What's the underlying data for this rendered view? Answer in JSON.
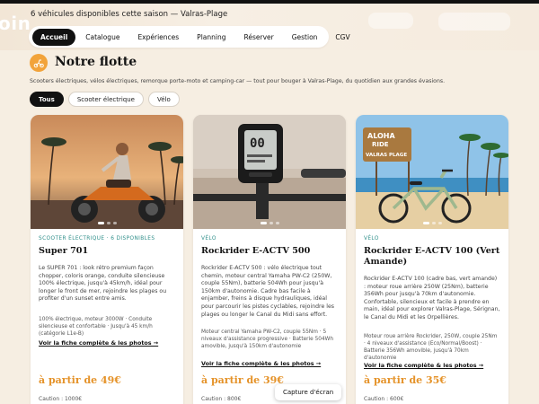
{
  "header": {
    "brand_fragment": "oin",
    "tagline": "6 véhicules disponibles cette saison — Valras-Plage"
  },
  "nav": {
    "items": [
      "Accueil",
      "Catalogue",
      "Expériences",
      "Planning",
      "Réserver",
      "Gestion",
      "CGV"
    ],
    "active": "Accueil"
  },
  "section": {
    "title": "Notre flotte",
    "description": "Scooters électriques, vélos électriques, remorque porte-moto et camping-car — tout pour bouger à Valras-Plage, du quotidien aux grandes évasions.",
    "icon": "scooter-icon"
  },
  "filters": [
    "Tous",
    "Scooter électrique",
    "Vélo"
  ],
  "cards": [
    {
      "category": "SCOOTER ÉLECTRIQUE · 6 DISPONIBLES",
      "name": "Super 701",
      "description": "Le SUPER 701 : look rétro premium façon chopper, coloris orange, conduite silencieuse 100% électrique, jusqu'à 45km/h, idéal pour longer le front de mer, rejoindre les plages ou profiter d'un sunset entre amis.",
      "specs": "100% électrique, moteur 3000W · Conduite silencieuse et confortable · Jusqu'à 45 km/h (catégorie L1e-B)",
      "link": "Voir la fiche complète & les photos →",
      "price": "à partir de 49€",
      "caution": "Caution : 1000€"
    },
    {
      "category": "VÉLO",
      "name": "Rockrider E-ACTV 500",
      "description": "Rockrider E-ACTV 500 : vélo électrique tout chemin, moteur central Yamaha PW-C2 (250W, couple 55Nm), batterie 504Wh pour jusqu'à 150km d'autonomie. Cadre bas facile à enjamber, freins à disque hydrauliques, idéal pour parcourir les pistes cyclables, rejoindre les plages ou longer le Canal du Midi sans effort.",
      "specs": "Moteur central Yamaha PW-C2, couple 55Nm · 5 niveaux d'assistance progressive · Batterie 504Wh amovible, jusqu'à 150km d'autonomie",
      "link": "Voir la fiche complète & les photos →",
      "price": "à partir de 39€",
      "caution": "Caution : 800€"
    },
    {
      "category": "VÉLO",
      "name": "Rockrider E-ACTV 100 (Vert Amande)",
      "description": "Rockrider E-ACTV 100 (cadre bas, vert amande) : moteur roue arrière 250W (25Nm), batterie 356Wh pour jusqu'à 70km d'autonomie. Confortable, silencieux et facile à prendre en main, idéal pour explorer Valras-Plage, Sérignan, le Canal du Midi et les Orpellières.",
      "specs": "Moteur roue arrière Rockrider, 250W, couple 25Nm · 4 niveaux d'assistance (Eco/Normal/Boost) · Batterie 356Wh amovible, jusqu'à 70km d'autonomie",
      "link": "Voir la fiche complète & les photos →",
      "price": "à partir de 35€",
      "caution": "Caution : 600€"
    }
  ],
  "photo_sign": {
    "line1": "ALOHA",
    "line2": "RIDE",
    "line3": "VALRAS PLAGE"
  },
  "screen_lcd": "00",
  "capture_button": "Capture d'écran",
  "colors": {
    "accent": "#e5932a",
    "category_teal": "#2f8f8a",
    "dark": "#111111",
    "background": "#f6eee2"
  }
}
